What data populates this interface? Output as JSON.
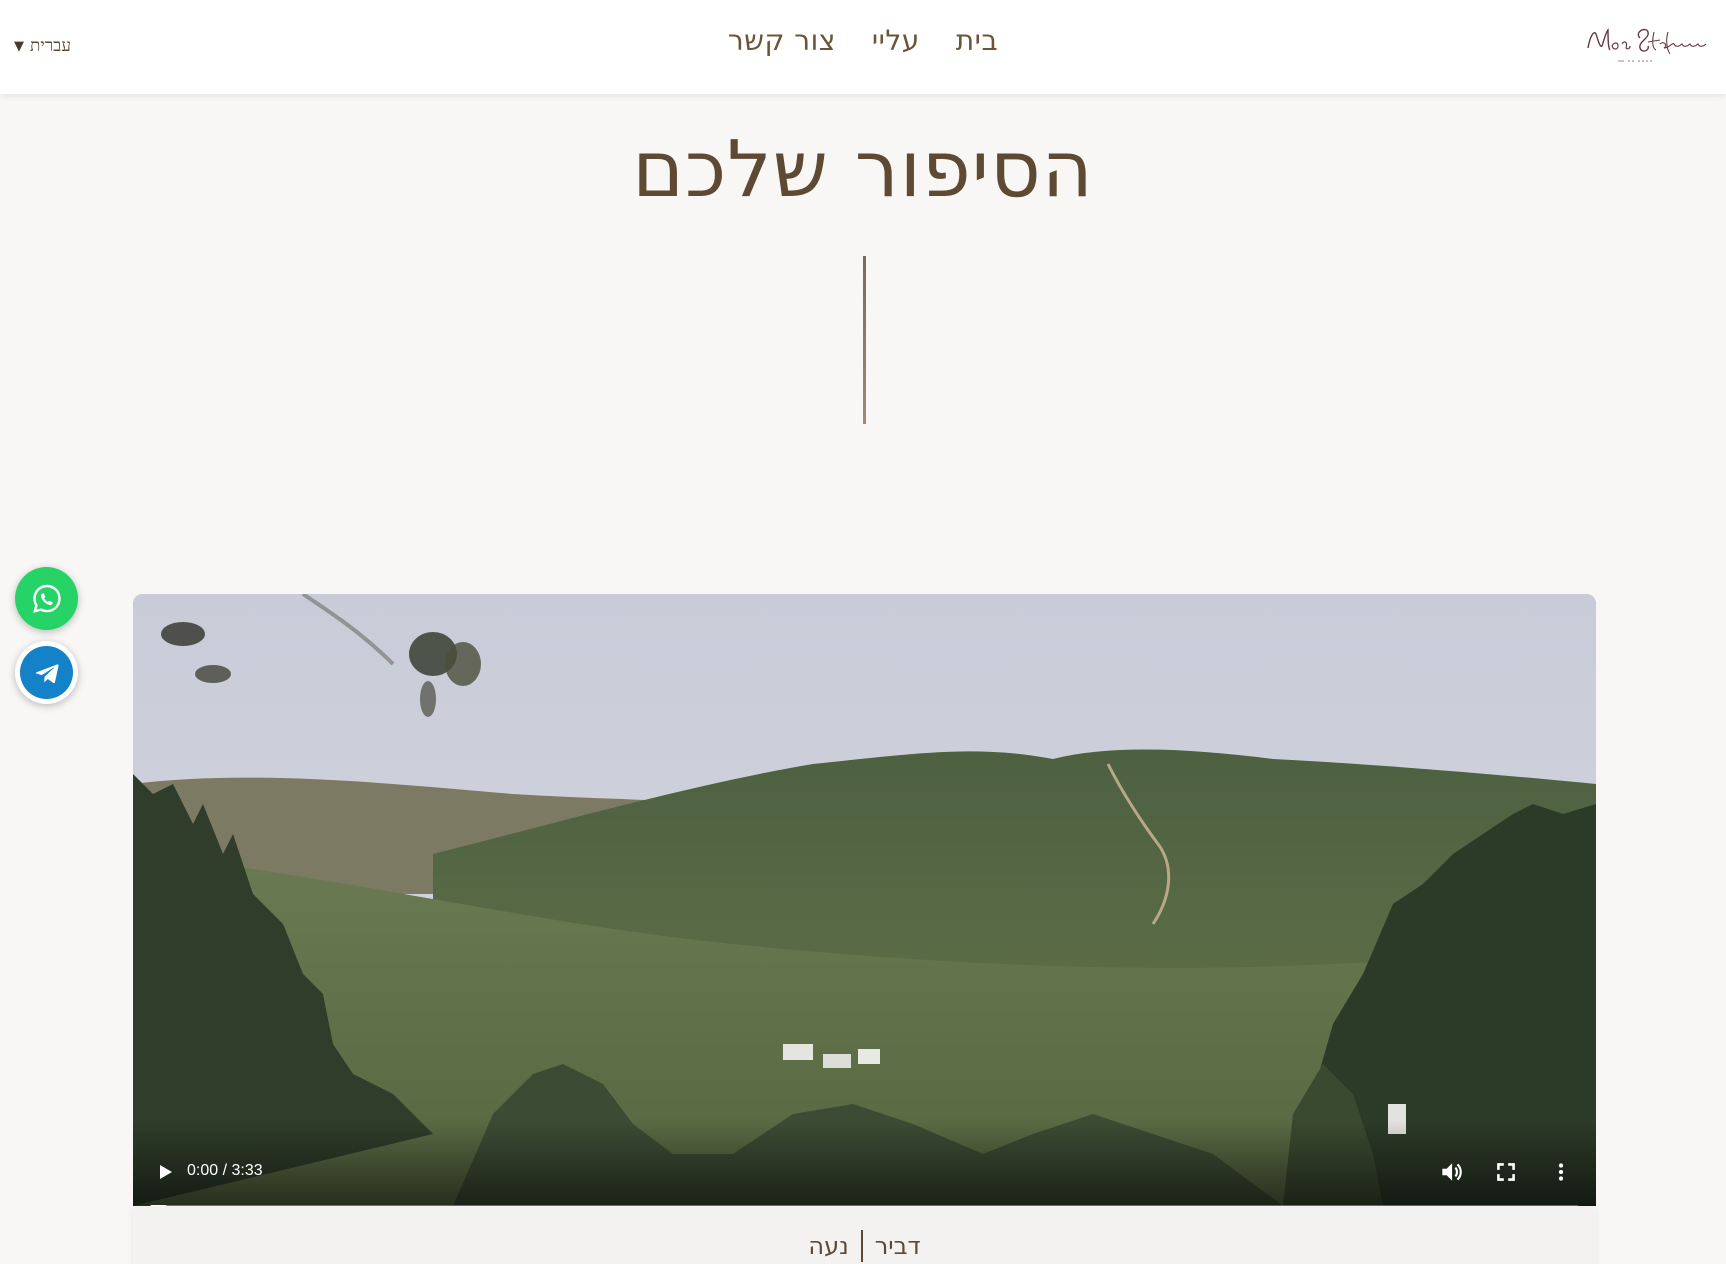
{
  "header": {
    "language": "עברית",
    "nav": [
      {
        "label": "בית"
      },
      {
        "label": "עליי"
      },
      {
        "label": "צור קשר"
      }
    ],
    "logo_icon": "noa-stefanian-signature-logo"
  },
  "main": {
    "title": "הסיפור שלכם"
  },
  "video": {
    "time": "0:00 / 3:33",
    "progress": 0.0,
    "icons": [
      "play-icon",
      "volume-icon",
      "fullscreen-icon",
      "more-options-icon"
    ]
  },
  "caption": {
    "name_1": "דביר",
    "name_2": "נעה"
  },
  "floating": {
    "whatsapp_icon": "whatsapp-icon",
    "telegram_icon": "telegram-icon",
    "colors": {
      "whatsapp": "#25d366",
      "telegram": "#1482c8"
    }
  }
}
